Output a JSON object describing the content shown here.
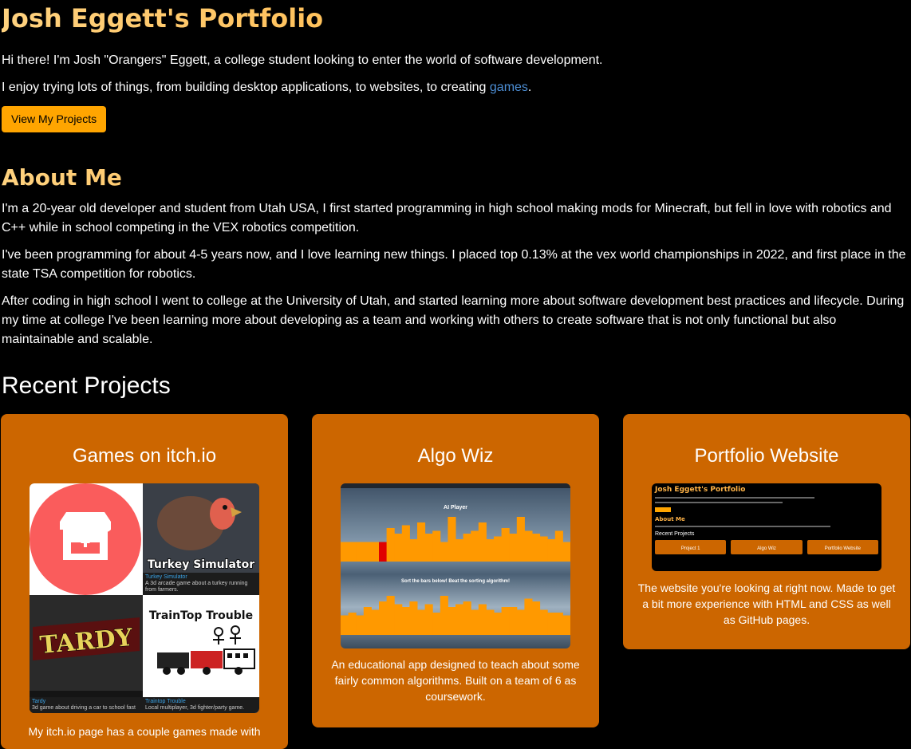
{
  "header": {
    "title": "Josh Eggett's Portfolio",
    "intro_1": "Hi there! I'm Josh \"Orangers\" Eggett, a college student looking to enter the world of software development.",
    "intro_2_prefix": "I enjoy trying lots of things, from building desktop applications, to websites, to creating ",
    "intro_2_link": "games",
    "intro_2_suffix": ".",
    "button_label": "View My Projects"
  },
  "about": {
    "heading": "About Me",
    "paragraphs": [
      "I'm a 20-year old developer and student from Utah USA, I first started programming in high school making mods for Minecraft, but fell in love with robotics and C++ while in school competing in the VEX robotics competition.",
      "I've been programming for about 4-5 years now, and I love learning new things. I placed top 0.13% at the vex world championships in 2022, and first place in the state TSA competition for robotics.",
      "After coding in high school I went to college at the University of Utah, and started learning more about software development best practices and lifecycle. During my time at college I've been learning more about developing as a team and working with others to create software that is not only functional but also maintainable and scalable."
    ]
  },
  "projects": {
    "heading": "Recent Projects",
    "items": [
      {
        "title": "Games on itch.io",
        "description": "My itch.io page has a couple games made with",
        "thumb": {
          "games": [
            {
              "name": "Turkey Simulator",
              "blurb": "A 3d arcade game about a turkey running from farmers.",
              "logo_text": "Turkey Simulator"
            },
            {
              "name": "Tardy",
              "blurb": "3d game about driving a car to school fast",
              "logo_text": "TARDY"
            },
            {
              "name": "Traintop Trouble",
              "blurb": "Local multiplayer, 3d fighter/party game.",
              "logo_text": "TrainTop Trouble"
            }
          ]
        }
      },
      {
        "title": "Algo Wiz",
        "description": "An educational app designed to teach about some fairly common algorithms. Built on a team of 6 as coursework.",
        "thumb": {
          "player_label": "AI Player",
          "prompt": "Sort the bars below! Beat the sorting algorithm!",
          "bars_top": [
            0.35,
            0.35,
            0.35,
            0.35,
            0.35,
            0.35,
            0.6,
            0.5,
            0.65,
            0.4,
            0.7,
            0.5,
            0.55,
            0.35,
            0.8,
            0.4,
            0.5,
            0.55,
            0.7,
            0.4,
            0.45,
            0.6,
            0.5,
            0.8,
            0.55,
            0.5,
            0.45,
            0.4,
            0.55,
            0.35
          ],
          "bars_bottom": [
            0.35,
            0.4,
            0.35,
            0.5,
            0.45,
            0.6,
            0.7,
            0.55,
            0.5,
            0.6,
            0.45,
            0.55,
            0.4,
            0.7,
            0.5,
            0.55,
            0.6,
            0.45,
            0.55,
            0.45,
            0.4,
            0.5,
            0.5,
            0.45,
            0.65,
            0.6,
            0.45,
            0.4,
            0.4,
            0.35
          ]
        }
      },
      {
        "title": "Portfolio Website",
        "description": "The website you're looking at right now. Made to get a bit more experience with HTML and CSS as well as GitHub pages.",
        "thumb": {
          "mini_title": "Josh Eggett's Portfolio",
          "mini_about": "About Me",
          "mini_recent": "Recent Projects",
          "mini_cards": [
            "Project 1",
            "Algo Wiz",
            "Portfolio Website"
          ]
        }
      }
    ]
  },
  "colors": {
    "accent": "#ffa500",
    "card": "#cc6600",
    "link": "#4d8fd6",
    "title_gradient_start": "#ffd27f",
    "title_gradient_end": "#ffa31a"
  }
}
